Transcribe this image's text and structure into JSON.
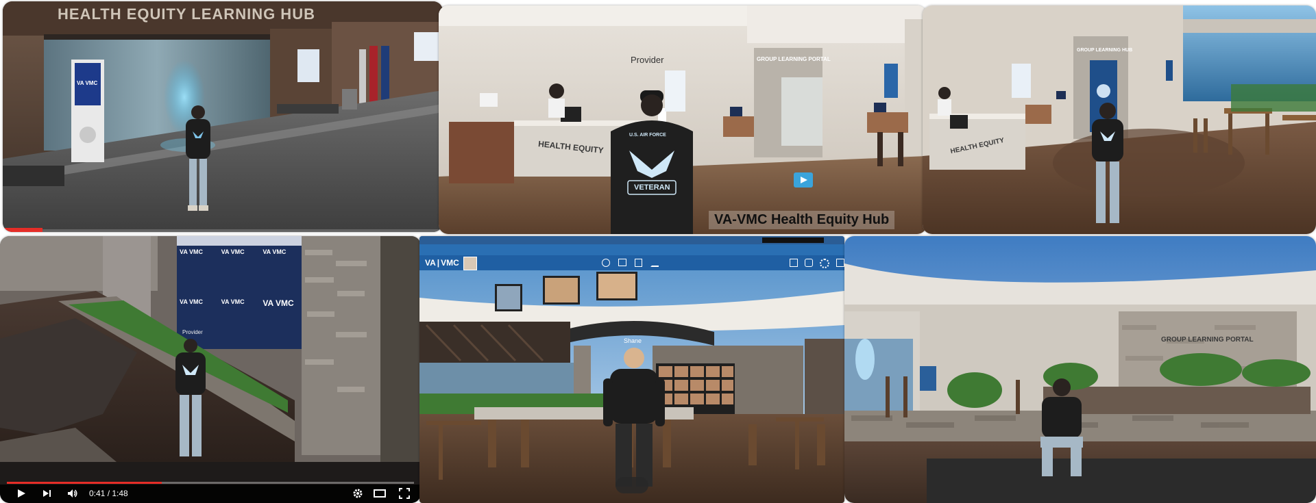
{
  "panel1": {
    "wall_sign": "HEALTH EQUITY LEARNING HUB",
    "kiosk_label": "VA VMC"
  },
  "panel2": {
    "provider_label": "Provider",
    "portal_sign": "GROUP LEARNING PORTAL",
    "desk_sign": "HEALTH EQUITY",
    "jacket_top": "U.S. AIR FORCE",
    "jacket_bottom": "VETERAN",
    "caption": "VA-VMC Health Equity Hub"
  },
  "panel3": {
    "portal_sign": "GROUP LEARNING HUB",
    "desk_sign": "HEALTH EQUITY"
  },
  "panel4": {
    "backdrop_logo": "VA VMC",
    "avatar_label": "Provider",
    "player": {
      "current_time": "0:41",
      "duration": "1:48",
      "time_separator": " / ",
      "progress_fraction": 0.38
    }
  },
  "panel5": {
    "app_logo": "VA",
    "app_logo_b": "VMC",
    "avatar_label": "Shane"
  },
  "panel6": {
    "portal_sign": "GROUP LEARNING PORTAL"
  },
  "colors": {
    "navy": "#1c2f5c",
    "wood": "#6b4b35",
    "youtube_red": "#e52d27",
    "vmc_blue": "#2a6fb3"
  }
}
